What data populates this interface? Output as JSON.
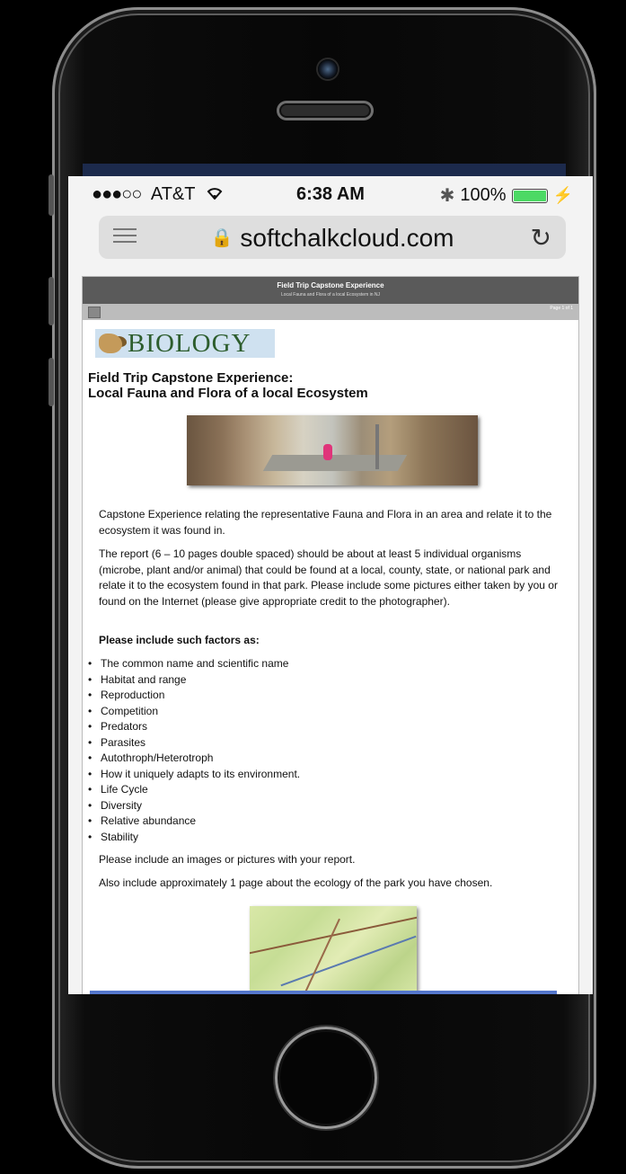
{
  "status_bar": {
    "signal": "●●●○○",
    "carrier": "AT&T",
    "wifi_icon": "wifi-icon",
    "time": "6:38 AM",
    "bluetooth_icon": "bluetooth-icon",
    "battery": "100%",
    "battery_level": 1.0
  },
  "browser": {
    "url": "softchalkcloud.com",
    "menu_icon": "hamburger-icon",
    "lock_icon": "lock-icon",
    "reload_icon": "reload-icon"
  },
  "page": {
    "header_title": "Field Trip Capstone Experience",
    "header_subtitle": "Local Fauna and Flora of a local Ecosystem in NJ",
    "page_indicator": "Page 1 of 1",
    "logo_text": "BIOLOGY",
    "title_line1": "Field Trip Capstone Experience:",
    "title_line2": "Local Fauna and Flora of a local Ecosystem",
    "paragraph1": "Capstone Experience relating the representative Fauna and Flora in an area and relate it to the ecosystem it was found in.",
    "paragraph2": "The report (6 – 10 pages double spaced) should be about at least 5 individual organisms (microbe, plant and/or animal) that could be found at a local, county, state, or national park and relate it to the ecosystem found in that park. Please include some pictures either taken by you or found on the Internet (please give appropriate credit to the photographer).",
    "factors_heading": "Please include such factors as:",
    "factors": [
      "The common name and scientific name",
      "Habitat and range",
      "Reproduction",
      "Competition",
      "Predators",
      "Parasites",
      "Autothroph/Heterotroph",
      "How it uniquely adapts to its environment.",
      "Life Cycle",
      "Diversity",
      "Relative abundance",
      "Stability"
    ],
    "paragraph3": "Please include an images or pictures with your report.",
    "paragraph4": "Also include approximately 1 page about the ecology of the park you have chosen."
  },
  "colors": {
    "battery_green": "#4cd964",
    "header_gray": "#5a5a5a",
    "logo_green": "#2d5d2d"
  }
}
